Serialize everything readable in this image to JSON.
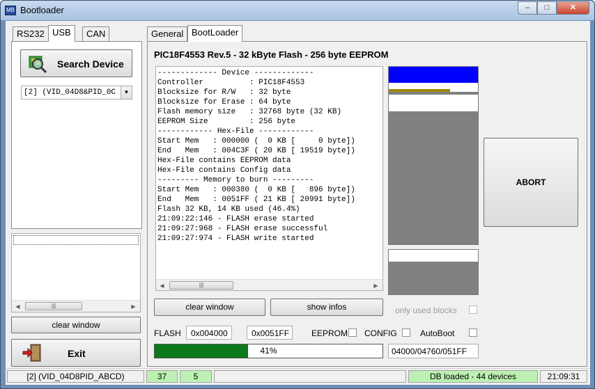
{
  "window": {
    "title": "Bootloader",
    "minimize": "–",
    "maximize": "□",
    "close": "✕",
    "app_icon": "MB"
  },
  "left_tabs": [
    {
      "label": "RS232"
    },
    {
      "label": "USB"
    },
    {
      "label": "CAN"
    }
  ],
  "search_button": {
    "label": "Search Device"
  },
  "device_select": {
    "value": "[2] (VID_04D8&PID_0C"
  },
  "left_clear_button": {
    "label": "clear window"
  },
  "exit_button": {
    "label": "Exit"
  },
  "right_tabs": [
    {
      "label": "General"
    },
    {
      "label": "BootLoader"
    }
  ],
  "device_header": "PIC18F4553 Rev.5 - 32 kByte Flash - 256 byte EEPROM",
  "log_lines": [
    "------------- Device -------------",
    "Controller          : PIC18F4553",
    "Blocksize for R/W   : 32 byte",
    "Blocksize for Erase : 64 byte",
    "Flash memory size   : 32768 byte (32 KB)",
    "EEPROM Size         : 256 byte",
    "------------ Hex-File ------------",
    "Start Mem   : 000000 (  0 KB [     0 byte])",
    "End   Mem   : 004C3F ( 20 KB [ 19519 byte])",
    "Hex-File contains EEPROM data",
    "Hex-File contains Config data",
    "--------- Memory to burn ---------",
    "Start Mem   : 000380 (  0 KB [   896 byte])",
    "End   Mem   : 0051FF ( 21 KB [ 20991 byte])",
    "Flash 32 KB, 14 KB used (46.4%)",
    "21:09:22:146 - FLASH erase started",
    "21:09:27:968 - FLASH erase successful",
    "21:09:27:974 - FLASH write started"
  ],
  "clear_window_button": {
    "label": "clear window"
  },
  "show_infos_button": {
    "label": "show infos"
  },
  "used_blocks": {
    "label": "only used blocks"
  },
  "abort_button": {
    "label": "ABORT"
  },
  "flash": {
    "label": "FLASH",
    "start": "0x004000",
    "end": "0x0051FF"
  },
  "eeprom": {
    "label": "EEPROM"
  },
  "config": {
    "label": "CONFIG"
  },
  "autoboot": {
    "label": "AutoBoot"
  },
  "progress": {
    "value": 0.41,
    "text": "41%",
    "address_text": "04000/04760/051FF"
  },
  "statusbar": {
    "device": "[2] (VID_04D8PID_ABCD)",
    "count1": "37",
    "count2": "5",
    "db_status": "DB loaded - 44 devices",
    "time": "21:09:31"
  },
  "colors": {
    "progress_fill": "#0c7a1c",
    "status_green": "#bdf1b3",
    "memmap_blue": "#0000ff",
    "memmap_gray": "#808080",
    "memmap_olive": "#a08800"
  },
  "icons": {
    "search": "search-device-icon",
    "exit": "exit-door-icon"
  }
}
